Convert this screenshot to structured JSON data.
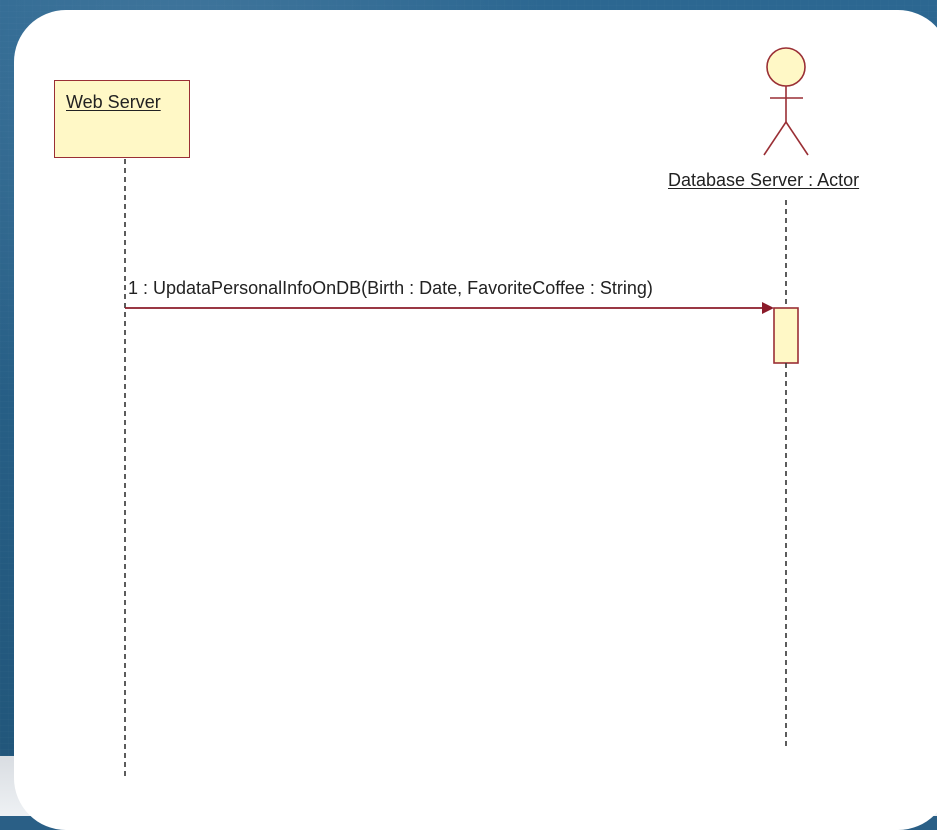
{
  "diagram": {
    "lifeline_left": {
      "label": "Web Server"
    },
    "lifeline_right": {
      "label": "Database Server : Actor"
    },
    "message": {
      "label": "1 : UpdataPersonalInfoOnDB(Birth : Date, FavoriteCoffee : String)"
    }
  },
  "colors": {
    "background": "#2a5f86",
    "card": "#ffffff",
    "lifeline_fill": "#fff8c6",
    "line": "#9a2f35",
    "text": "#222222"
  }
}
